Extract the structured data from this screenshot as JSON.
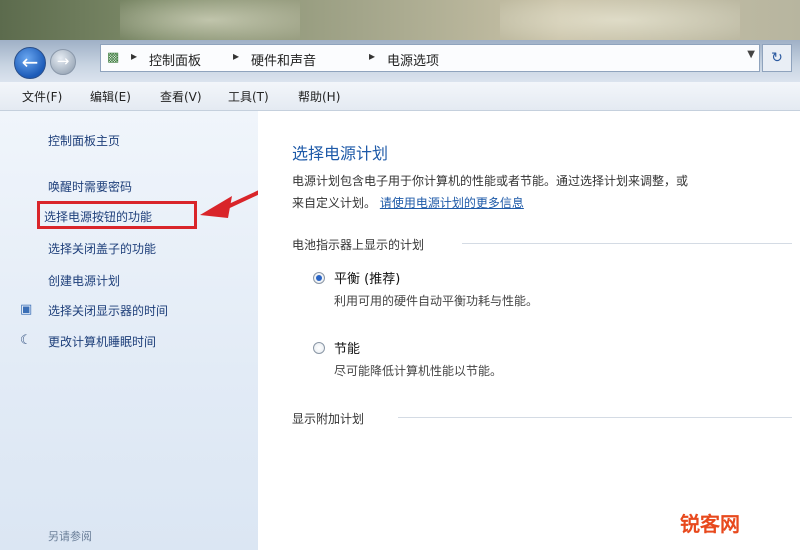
{
  "breadcrumb": {
    "items": [
      "控制面板",
      "硬件和声音",
      "电源选项"
    ]
  },
  "menu": {
    "items": [
      "文件(F)",
      "编辑(E)",
      "查看(V)",
      "工具(T)",
      "帮助(H)"
    ]
  },
  "sidebar": {
    "home": "控制面板主页",
    "links": [
      "唤醒时需要密码",
      "选择电源按钮的功能",
      "选择关闭盖子的功能",
      "创建电源计划",
      "选择关闭显示器的时间",
      "更改计算机睡眠时间"
    ],
    "see_also": "另请参阅"
  },
  "main": {
    "title": "选择电源计划",
    "description_1": "电源计划包含电子用于你计算机的性能或者节能。通过选择计划来调整，或",
    "description_2": "来自定义计划。",
    "description_link": "请使用电源计划的更多信息",
    "section_preferred": "电池指示器上显示的计划",
    "plans": [
      {
        "name": "平衡 (推荐)",
        "desc": "利用可用的硬件自动平衡功耗与性能。",
        "selected": true
      },
      {
        "name": "节能",
        "desc": "尽可能降低计算机性能以节能。",
        "selected": false
      }
    ],
    "section_additional": "显示附加计划"
  },
  "watermark": "锐客网",
  "colors": {
    "accent": "#1e5aa8",
    "highlight": "#d9252a"
  }
}
